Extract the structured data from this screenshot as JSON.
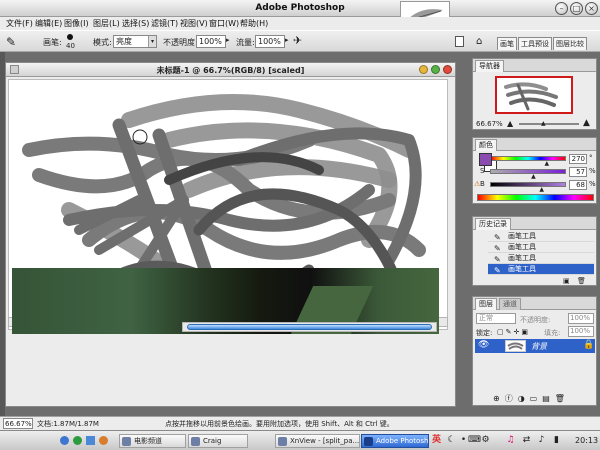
{
  "window": {
    "title": "Adobe Photoshop",
    "control_glyphs": {
      "minimize": "–",
      "maximize": "□",
      "close": "×"
    }
  },
  "menu": [
    "文件(F)",
    "编辑(E)",
    "图像(I)",
    "图层(L)",
    "选择(S)",
    "滤镜(T)",
    "视图(V)",
    "窗口(W)",
    "帮助(H)"
  ],
  "options": {
    "brush_label": "画笔:",
    "brush_size": "40",
    "mode_label": "模式:",
    "mode_value": "亮度",
    "opacity_label": "不透明度:",
    "opacity_value": "100%",
    "flow_label": "流量:",
    "flow_value": "100%",
    "palette_tabs": [
      "画笔",
      "工具预设",
      "图层比较"
    ]
  },
  "document": {
    "title": "未标题-1 @ 66.7%(RGB/8) [scaled]",
    "stroke_color": "#6b6b6b",
    "zoom": "66.67%",
    "doc_size": "文档:1.87M/1.87M",
    "hint": "点按并拖移以用前景色绘画。要用附加选项，使用 Shift、Alt 和 Ctrl 键。"
  },
  "navigator": {
    "tab": "导航器",
    "zoom": "66.67%",
    "view_box_color": "#d01a1a"
  },
  "color": {
    "tab": "颜色",
    "sliders": [
      {
        "label": "H",
        "value": "270",
        "unit": "°",
        "level": 0.75
      },
      {
        "label": "S",
        "value": "57",
        "unit": "%",
        "level": 0.57
      },
      {
        "label": "B",
        "value": "68",
        "unit": "%",
        "level": 0.68
      }
    ],
    "foreground": "#8a4cae",
    "background": "#ffffff"
  },
  "history": {
    "tab": "历史记录",
    "items": [
      "画笔工具",
      "画笔工具",
      "画笔工具",
      "画笔工具"
    ],
    "selected_index": 3
  },
  "layers": {
    "tabs": [
      "图层",
      "通道"
    ],
    "mode": "正常",
    "opacity_label": "不透明度:",
    "opacity_value": "100%",
    "lock_label": "锁定:",
    "fill_label": "填充:",
    "fill_value": "100%",
    "layer_name": "背景"
  },
  "taskbar": {
    "items": [
      "电影频道",
      "Craig",
      "XnView - [split_pa...",
      "Adobe Photoshop"
    ],
    "active_index": 3,
    "ime": "英",
    "clock": "20:13"
  }
}
